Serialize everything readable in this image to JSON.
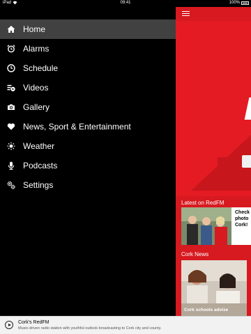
{
  "status_bar": {
    "carrier": "iPad",
    "time": "09:41",
    "battery": "100%"
  },
  "menu": {
    "items": [
      {
        "label": "Home",
        "icon": "home-icon",
        "active": true
      },
      {
        "label": "Alarms",
        "icon": "alarm-clock-icon"
      },
      {
        "label": "Schedule",
        "icon": "clock-icon"
      },
      {
        "label": "Videos",
        "icon": "video-playlist-icon"
      },
      {
        "label": "Gallery",
        "icon": "camera-icon"
      },
      {
        "label": "News, Sport & Entertainment",
        "icon": "heart-icon"
      },
      {
        "label": "Weather",
        "icon": "sun-icon"
      },
      {
        "label": "Podcasts",
        "icon": "microphone-icon"
      },
      {
        "label": "Settings",
        "icon": "gears-icon"
      }
    ]
  },
  "main": {
    "latest": {
      "title": "Latest on RedFM",
      "card_text": [
        "Check",
        "photo",
        "Cork!"
      ]
    },
    "news": {
      "title": "Cork News",
      "caption": "Cork schools advise"
    }
  },
  "player": {
    "station": "Cork's RedFM",
    "description": "Music-driven radio station with youthful outlook broadcasting to Cork city and county."
  },
  "colors": {
    "brand_red": "#d71920",
    "drawer_bg": "#000000",
    "active_item": "#414141"
  }
}
